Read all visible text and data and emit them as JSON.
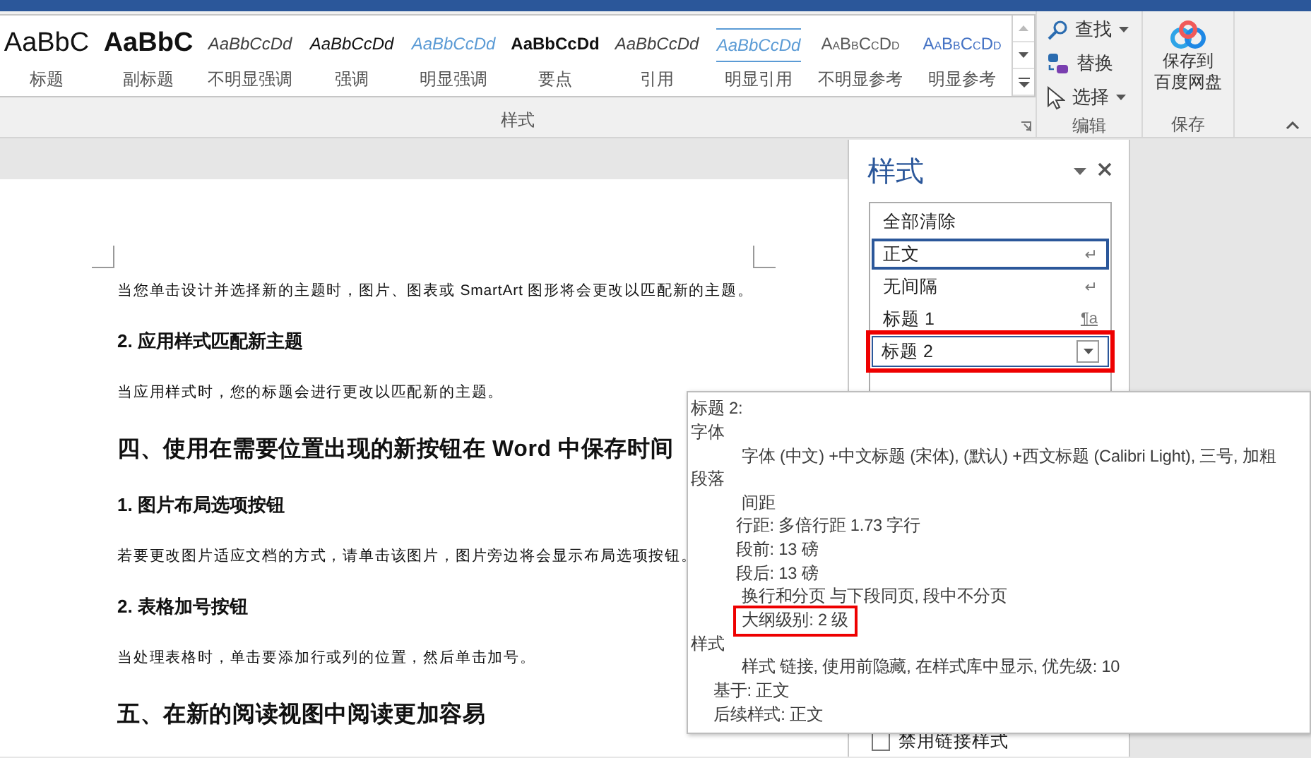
{
  "ribbon": {
    "styles_group": {
      "label": "样式",
      "gallery": [
        {
          "preview": "AaBbC",
          "label": "标题",
          "kind": "title"
        },
        {
          "preview": "AaBbC",
          "label": "副标题",
          "kind": "subtitle"
        },
        {
          "preview": "AaBbCcDd",
          "label": "不明显强调",
          "kind": "subtle-emphasis"
        },
        {
          "preview": "AaBbCcDd",
          "label": "强调",
          "kind": "emphasis"
        },
        {
          "preview": "AaBbCcDd",
          "label": "明显强调",
          "kind": "intense-emphasis"
        },
        {
          "preview": "AaBbCcDd",
          "label": "要点",
          "kind": "strong"
        },
        {
          "preview": "AaBbCcDd",
          "label": "引用",
          "kind": "quote"
        },
        {
          "preview": "AaBbCcDd",
          "label": "明显引用",
          "kind": "intense-quote"
        },
        {
          "preview": "AaBbCcDd",
          "label": "不明显参考",
          "kind": "subtle-reference"
        },
        {
          "preview": "AaBbCcDd",
          "label": "明显参考",
          "kind": "intense-reference"
        }
      ]
    },
    "editing_group": {
      "label": "编辑",
      "commands": [
        {
          "label": "查找",
          "kind": "search",
          "has_menu": true
        },
        {
          "label": "替换",
          "kind": "replace",
          "has_menu": false
        },
        {
          "label": "选择",
          "kind": "select",
          "has_menu": true
        }
      ]
    },
    "save_group": {
      "label": "保存",
      "button": {
        "lines": [
          "保存到",
          "百度网盘"
        ]
      }
    }
  },
  "document": {
    "blocks": [
      {
        "kind": "paragraph",
        "text": "当您单击设计并选择新的主题时，图片、图表或 SmartArt 图形将会更改以匹配新的主题。"
      },
      {
        "kind": "heading-3",
        "text": "2. 应用样式匹配新主题"
      },
      {
        "kind": "paragraph",
        "text": "当应用样式时，您的标题会进行更改以匹配新的主题。"
      },
      {
        "kind": "heading-2",
        "text": "四、使用在需要位置出现的新按钮在 Word 中保存时间"
      },
      {
        "kind": "heading-3",
        "text": "1.  图片布局选项按钮"
      },
      {
        "kind": "paragraph",
        "text": "若要更改图片适应文档的方式，请单击该图片，图片旁边将会显示布局选项按钮。"
      },
      {
        "kind": "heading-3",
        "text": "2. 表格加号按钮"
      },
      {
        "kind": "paragraph",
        "text": "当处理表格时，单击要添加行或列的位置，然后单击加号。"
      },
      {
        "kind": "heading-2",
        "text": "五、在新的阅读视图中阅读更加容易"
      }
    ]
  },
  "styles_pane": {
    "title": "样式",
    "items": [
      {
        "label": "全部清除",
        "selected": false,
        "hovered": false,
        "annotated": false
      },
      {
        "label": "正文",
        "mark": "↵",
        "selected": true,
        "hovered": false,
        "annotated": false
      },
      {
        "label": "无间隔",
        "mark": "↵",
        "selected": false,
        "hovered": false,
        "annotated": false
      },
      {
        "label": "标题 1",
        "mark": "¶a",
        "selected": false,
        "hovered": false,
        "annotated": false
      },
      {
        "label": "标题 2",
        "selected": false,
        "hovered": true,
        "annotated": true
      }
    ],
    "options": [
      {
        "label": "禁用链接样式",
        "checked": false
      }
    ]
  },
  "tooltip": {
    "lines": [
      {
        "kind": "title",
        "text": "标题 2:",
        "annotated": false
      },
      {
        "kind": "section",
        "text": "字体",
        "annotated": false
      },
      {
        "kind": "detail",
        "text": "字体 (中文) +中文标题 (宋体), (默认) +西文标题 (Calibri Light), 三号, 加粗",
        "annotated": false
      },
      {
        "kind": "section",
        "text": "段落",
        "annotated": false
      },
      {
        "kind": "detail",
        "text": "间距",
        "annotated": false
      },
      {
        "kind": "sub",
        "text": "行距: 多倍行距 1.73 字行",
        "annotated": false
      },
      {
        "kind": "sub",
        "text": "段前: 13 磅",
        "annotated": false
      },
      {
        "kind": "sub",
        "text": "段后: 13 磅",
        "annotated": false
      },
      {
        "kind": "detail",
        "text": "换行和分页 与下段同页, 段中不分页",
        "annotated": false
      },
      {
        "kind": "detail",
        "text": "大纲级别:  2 级",
        "annotated": true
      },
      {
        "kind": "section",
        "text": "样式",
        "annotated": false
      },
      {
        "kind": "detail",
        "text": "样式 链接, 使用前隐藏, 在样式库中显示, 优先级: 10",
        "annotated": false
      },
      {
        "kind": "meta",
        "text": "基于: 正文",
        "annotated": false
      },
      {
        "kind": "meta",
        "text": "后续样式: 正文",
        "annotated": false
      }
    ]
  }
}
